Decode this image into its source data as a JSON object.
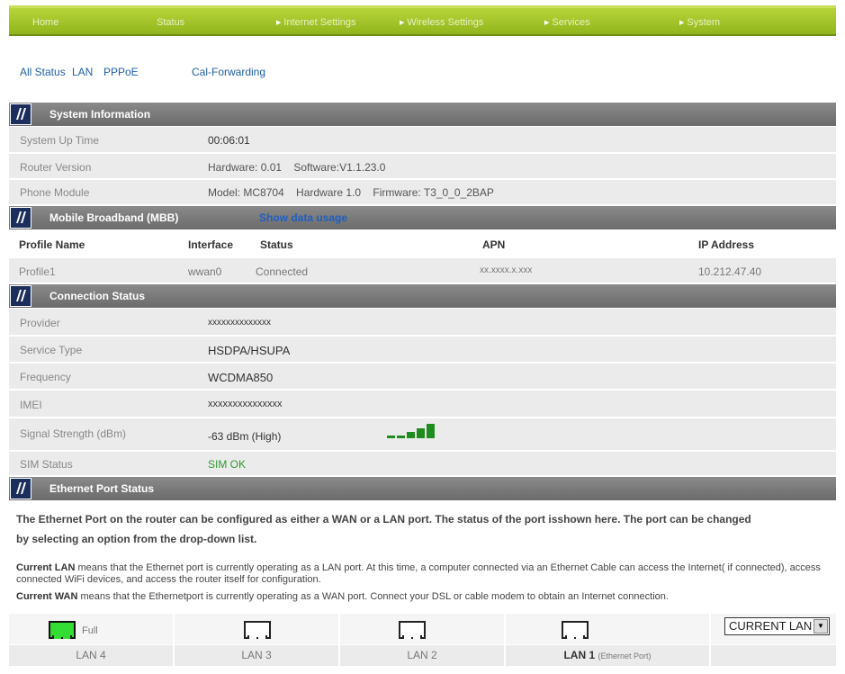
{
  "nav": {
    "items": [
      {
        "label": "Home",
        "arrow": false
      },
      {
        "label": "Status",
        "arrow": false
      },
      {
        "label": "Internet Settings",
        "arrow": true
      },
      {
        "label": "Wireless Settings",
        "arrow": true
      },
      {
        "label": "Services",
        "arrow": true
      },
      {
        "label": "System",
        "arrow": true
      }
    ]
  },
  "subnav": [
    "All Status",
    "LAN",
    "PPPoE",
    "Cal-Forwarding"
  ],
  "system_info": {
    "title": "System Information",
    "rows": [
      {
        "label": "System Up Time",
        "value": "00:06:01"
      },
      {
        "label": "Router Version",
        "value": "Hardware: 0.01    Software:V1.1.23.0"
      },
      {
        "label": "Phone Module",
        "value": "Model: MC8704    Hardware 1.0    Firmware: T3_0_0_2BAP"
      }
    ]
  },
  "mbb": {
    "title": "Mobile Broadband (MBB)",
    "link": "Show data usage",
    "headers": [
      "Profile Name",
      "Interface",
      "Status",
      "APN",
      "IP Address"
    ],
    "row": [
      "Profile1",
      "wwan0",
      "Connected",
      "xx.xxxx.x.xxx",
      "10.212.47.40"
    ]
  },
  "connection": {
    "title": "Connection Status",
    "rows": [
      {
        "label": "Provider",
        "value": "xxxxxxxxxxxxxx"
      },
      {
        "label": "Service Type",
        "value": "HSDPA/HSUPA"
      },
      {
        "label": "Frequency",
        "value": "WCDMA850"
      },
      {
        "label": "IMEI",
        "value": "xxxxxxxxxxxxxxx"
      },
      {
        "label": "Signal Strength (dBm)",
        "value": "-63 dBm (High)"
      },
      {
        "label": "SIM Status",
        "value": "SIM OK"
      }
    ],
    "signal_bars": 5
  },
  "ethernet": {
    "title": "Ethernet Port Status",
    "intro_line1": "The Ethernet Port on the router can be configured as either a WAN or a LAN port. The status of the port isshown here. The port can be changed",
    "intro_line2": "by selecting an option from the drop-down list.",
    "lan_term": "Current LAN",
    "lan_text": " means that the Ethernet port is currently operating as a LAN port. At this time, a computer connected via an Ethernet Cable can access the Internet( if connected), access connected WiFi devices, and access the router itself for configuration.",
    "wan_term": "Current WAN",
    "wan_text": " means that the Ethernetport is currently operating as a WAN port. Connect your DSL or cable modem to obtain an Internet connection.",
    "ports": [
      {
        "label": "LAN 4",
        "full": "Full",
        "active": true
      },
      {
        "label": "LAN 3",
        "active": false
      },
      {
        "label": "LAN 2",
        "active": false
      },
      {
        "label": "LAN 1",
        "note": "(Ethernet Port)",
        "active": false
      }
    ],
    "select_value": "CURRENT LAN"
  }
}
